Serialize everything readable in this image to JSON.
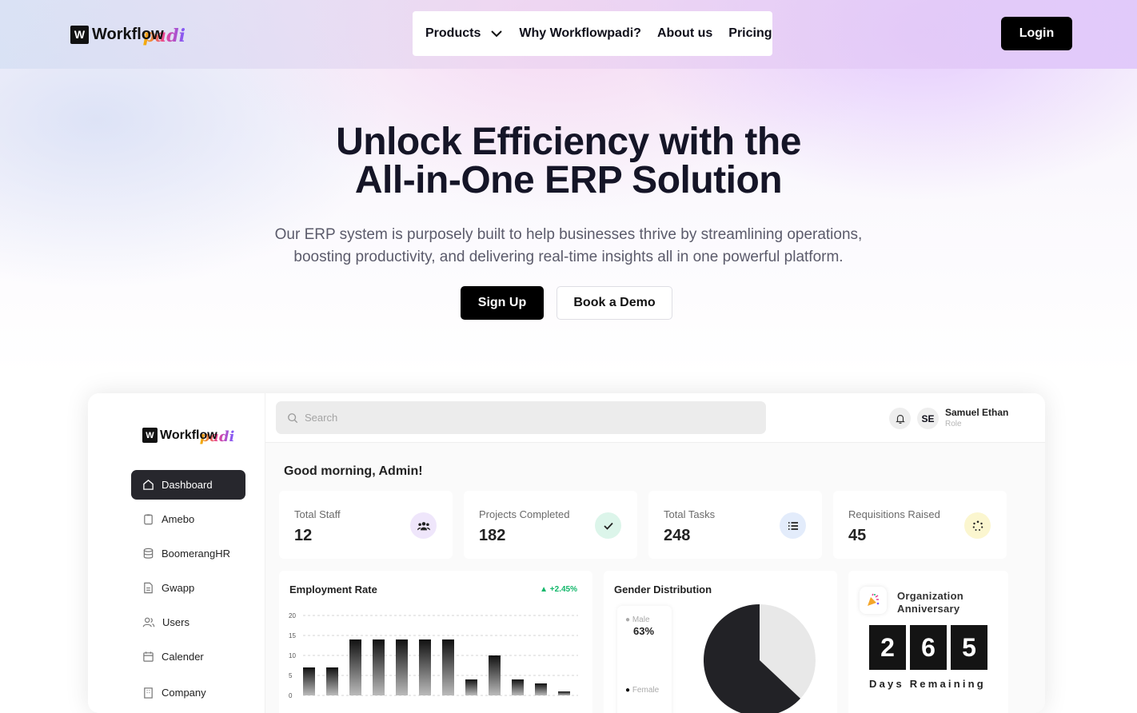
{
  "brand": {
    "mark": "W",
    "word": "Workflow",
    "script": "padi"
  },
  "nav": {
    "items": [
      {
        "label": "Products",
        "has_dropdown": true
      },
      {
        "label": "Why Workflowpadi?"
      },
      {
        "label": "About us"
      },
      {
        "label": "Pricing"
      }
    ],
    "login": "Login"
  },
  "hero": {
    "title_line1": "Unlock Efficiency with the",
    "title_line2": "All-in-One ERP Solution",
    "subtitle_line1": "Our ERP system is purposely built to help businesses thrive by streamlining operations,",
    "subtitle_line2": "boosting productivity, and delivering real-time insights all in one powerful platform.",
    "signup": "Sign Up",
    "demo": "Book a Demo"
  },
  "dashboard": {
    "search_placeholder": "Search",
    "user": {
      "initials": "SE",
      "name": "Samuel Ethan",
      "role": "Role"
    },
    "sidebar": [
      {
        "label": "Dashboard",
        "icon": "home-icon",
        "active": true
      },
      {
        "label": "Amebo",
        "icon": "clipboard-icon"
      },
      {
        "label": "BoomerangHR",
        "icon": "database-icon"
      },
      {
        "label": "Gwapp",
        "icon": "document-icon"
      },
      {
        "label": "Users",
        "icon": "users-icon"
      },
      {
        "label": "Calender",
        "icon": "calendar-icon"
      },
      {
        "label": "Company",
        "icon": "building-icon"
      }
    ],
    "greeting": "Good morning, Admin!",
    "stats": [
      {
        "label": "Total Staff",
        "value": "12",
        "icon": "team-icon",
        "color": "#efe6fb"
      },
      {
        "label": "Projects Completed",
        "value": "182",
        "icon": "check-icon",
        "color": "#dcf5ea"
      },
      {
        "label": "Total Tasks",
        "value": "248",
        "icon": "list-icon",
        "color": "#e3ecfb"
      },
      {
        "label": "Requisitions Raised",
        "value": "45",
        "icon": "loader-icon",
        "color": "#fbf6cf"
      }
    ],
    "employment": {
      "title": "Employment Rate",
      "trend": "+2.45%",
      "y_ticks": [
        "20",
        "15",
        "10",
        "5",
        "0"
      ],
      "bars": [
        7,
        7,
        14,
        14,
        14,
        14,
        14,
        4,
        10,
        4,
        3,
        1
      ]
    },
    "gender": {
      "title": "Gender Distribution",
      "male_label": "Male",
      "male_value": "63%",
      "female_label": "Female",
      "male_share": 0.63
    },
    "anniversary": {
      "title_line1": "Organization",
      "title_line2": "Anniversary",
      "digits": [
        "2",
        "6",
        "5"
      ],
      "caption": "Days Remaining"
    }
  }
}
